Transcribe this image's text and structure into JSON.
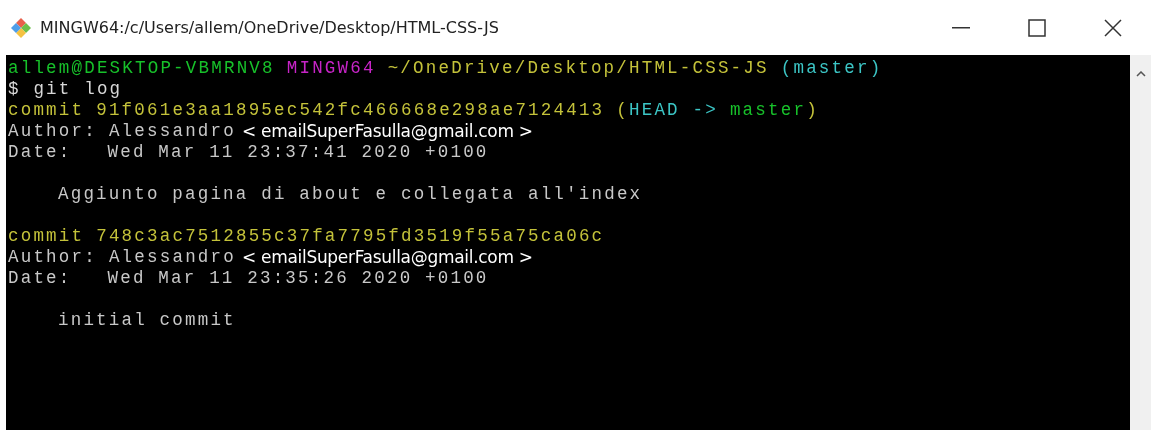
{
  "window": {
    "title": "MINGW64:/c/Users/allem/OneDrive/Desktop/HTML-CSS-JS"
  },
  "prompt": {
    "user_host": "allem@DESKTOP-VBMRNV8",
    "system": "MINGW64",
    "path": "~/OneDrive/Desktop/HTML-CSS-JS",
    "branch": "(master)"
  },
  "command": "$ git log",
  "commits": [
    {
      "label": "commit",
      "hash": "91f061e3aa1895ec542fc466668e298ae7124413",
      "refs": {
        "open": "(",
        "head": "HEAD ->",
        "branch": "master",
        "close": ")"
      },
      "author_label": "Author:",
      "author_name": "Alessandro",
      "email": "< emailSuperFasulla@gmail.com >",
      "date_label": "Date:",
      "date": "Wed Mar 11 23:37:41 2020 +0100",
      "message": "Aggiunto pagina di about e collegata all'index"
    },
    {
      "label": "commit",
      "hash": "748c3ac7512855c37fa7795fd3519f55a75ca06c",
      "author_label": "Author:",
      "author_name": "Alessandro",
      "email": "< emailSuperFasulla@gmail.com >",
      "date_label": "Date:",
      "date": "Wed Mar 11 23:35:26 2020 +0100",
      "message": "initial commit"
    }
  ]
}
